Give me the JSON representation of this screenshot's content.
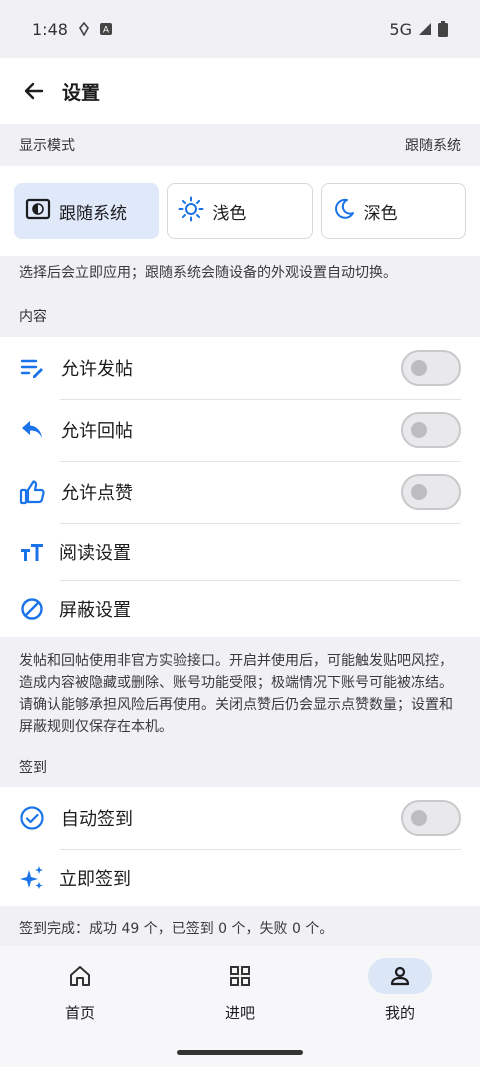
{
  "status": {
    "time": "1:48",
    "network": "5G"
  },
  "appbar": {
    "title": "设置"
  },
  "display": {
    "header": "显示模式",
    "current": "跟随系统",
    "modes": [
      {
        "label": "跟随系统",
        "icon": "brightness-auto-icon",
        "selected": true
      },
      {
        "label": "浅色",
        "icon": "sun-icon",
        "selected": false
      },
      {
        "label": "深色",
        "icon": "moon-icon",
        "selected": false
      }
    ],
    "note": "选择后会立即应用；跟随系统会随设备的外观设置自动切换。"
  },
  "content": {
    "header": "内容",
    "items": [
      {
        "label": "允许发帖",
        "icon": "post-icon",
        "toggle": false
      },
      {
        "label": "允许回帖",
        "icon": "reply-icon",
        "toggle": false
      },
      {
        "label": "允许点赞",
        "icon": "thumb-up-icon",
        "toggle": false
      },
      {
        "label": "阅读设置",
        "icon": "text-size-icon"
      },
      {
        "label": "屏蔽设置",
        "icon": "block-icon"
      }
    ],
    "note": "发帖和回帖使用非官方实验接口。开启并使用后，可能触发贴吧风控，造成内容被隐藏或删除、账号功能受限；极端情况下账号可能被冻结。请确认能够承担风险后再使用。关闭点赞后仍会显示点赞数量；设置和屏蔽规则仅保存在本机。"
  },
  "signin": {
    "header": "签到",
    "items": [
      {
        "label": "自动签到",
        "icon": "check-circle-icon",
        "toggle": false
      },
      {
        "label": "立即签到",
        "icon": "sparkle-icon"
      }
    ],
    "note": "签到完成：成功 49 个，已签到 0 个，失败 0 个。"
  },
  "nav": {
    "items": [
      {
        "label": "首页",
        "icon": "home-icon",
        "active": false
      },
      {
        "label": "进吧",
        "icon": "grid-icon",
        "active": false
      },
      {
        "label": "我的",
        "icon": "person-icon",
        "active": true
      }
    ]
  },
  "colors": {
    "accent": "#1a73e8",
    "selected_bg": "#dfe9f9"
  }
}
